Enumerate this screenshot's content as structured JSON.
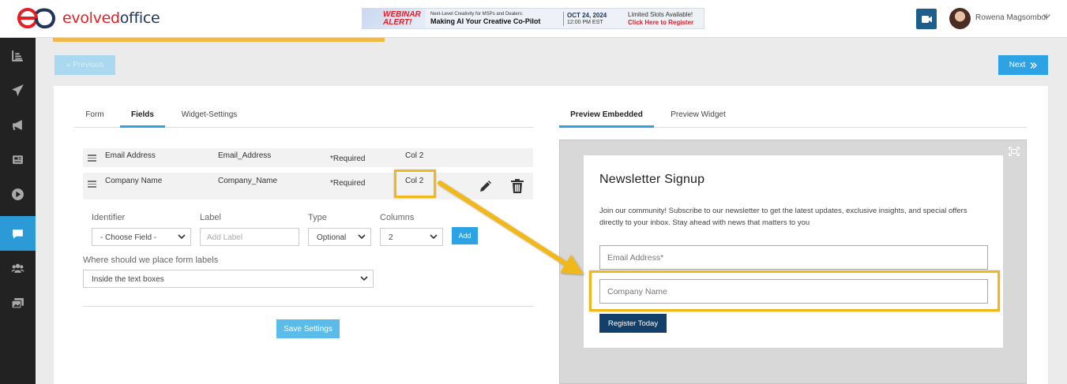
{
  "header": {
    "logo_evolved": "evolved",
    "logo_office": "office",
    "banner": {
      "alert": "WEBINAR ALERT!",
      "subtitle": "Next-Level Creativity for MSPs and Dealers:",
      "title": "Making AI Your Creative Co-Pilot",
      "date": "OCT 24, 2024",
      "time": "12:00 PM EST",
      "cta_line1": "Limited Slots Available!",
      "cta_line2": "Click Here to Register"
    },
    "user_name": "Rowena Magsombol"
  },
  "sidebar": {
    "items": [
      {
        "name": "reports",
        "icon": "bar-chart-icon"
      },
      {
        "name": "campaigns",
        "icon": "paper-plane-icon"
      },
      {
        "name": "announcements",
        "icon": "megaphone-icon"
      },
      {
        "name": "content",
        "icon": "newspaper-icon"
      },
      {
        "name": "video",
        "icon": "play-circle-icon"
      },
      {
        "name": "forms",
        "icon": "chat-bubble-icon",
        "active": true
      },
      {
        "name": "contacts",
        "icon": "users-icon"
      },
      {
        "name": "media",
        "icon": "images-icon"
      }
    ]
  },
  "nav": {
    "previous_label": "« Previous",
    "next_label": "Next"
  },
  "left_tabs": [
    "Form",
    "Fields",
    "Widget-Settings"
  ],
  "left_active_tab": "Fields",
  "right_tabs": [
    "Preview Embedded",
    "Preview Widget"
  ],
  "right_active_tab": "Preview Embedded",
  "fields": [
    {
      "label": "Email Address",
      "identifier": "Email_Address",
      "required": "*Required",
      "column": "Col 2"
    },
    {
      "label": "Company Name",
      "identifier": "Company_Name",
      "required": "*Required",
      "column": "Col 2"
    }
  ],
  "add_field": {
    "identifier_label": "Identifier",
    "identifier_value": "- Choose Field -",
    "label_label": "Label",
    "label_placeholder": "Add Label",
    "type_label": "Type",
    "type_value": "Optional",
    "columns_label": "Columns",
    "columns_value": "2",
    "add_button": "Add"
  },
  "placement": {
    "label": "Where should we place form labels",
    "value": "Inside the text boxes"
  },
  "save_button": "Save Settings",
  "preview": {
    "title": "Newsletter Signup",
    "description": "Join our community! Subscribe to our newsletter to get the latest updates, exclusive insights, and special offers directly to your inbox. Stay ahead with news that matters to you",
    "email_placeholder": "Email Address*",
    "company_placeholder": "Company Name",
    "register_button": "Register Today"
  },
  "colors": {
    "accent": "#2da3e5",
    "highlight": "#f1b81a",
    "brand_red": "#e31e25",
    "brand_navy": "#1e3558",
    "register_button": "#133f6b"
  }
}
